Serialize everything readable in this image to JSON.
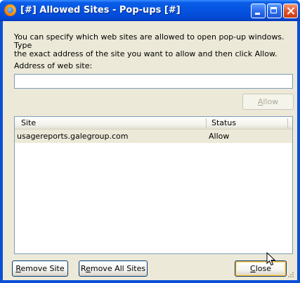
{
  "window": {
    "title": "[#] Allowed Sites - Pop-ups [#]"
  },
  "description": "You can specify which web sites are allowed to open pop-up windows. Type\nthe exact address of the site you want to allow and then click Allow.",
  "address": {
    "label": "Address of web site:",
    "value": "",
    "allow_label_accel": "A",
    "allow_label_rest": "llow"
  },
  "table": {
    "columns": [
      "Site",
      "Status"
    ],
    "rows": [
      {
        "site": "usagereports.galegroup.com",
        "status": "Allow"
      }
    ]
  },
  "buttons": {
    "remove_site_accel": "R",
    "remove_site_rest": "emove Site",
    "remove_all_pre": "R",
    "remove_all_accel": "e",
    "remove_all_rest": "move All Sites",
    "close_accel": "C",
    "close_rest": "lose"
  },
  "colors": {
    "titlebar": "#0553e0",
    "dialog_bg": "#ece9d8",
    "selected_row": "#ece9d8"
  }
}
